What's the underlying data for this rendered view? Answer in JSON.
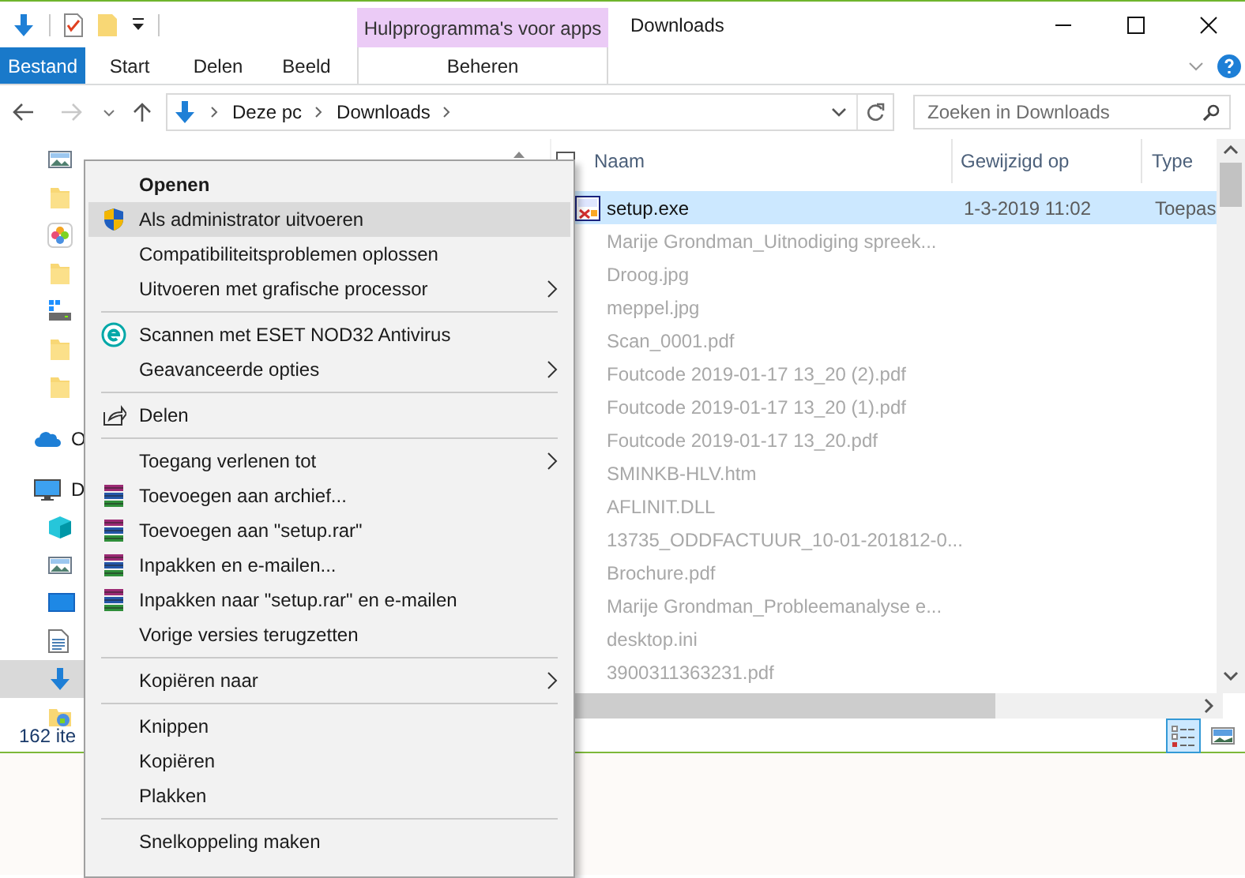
{
  "window": {
    "title": "Downloads",
    "context_tab": "Hulpprogramma's voor apps"
  },
  "ribbon": {
    "tabs": [
      {
        "label": "Bestand",
        "kind": "file",
        "selected": false
      },
      {
        "label": "Start",
        "kind": "tab",
        "selected": false
      },
      {
        "label": "Delen",
        "kind": "tab",
        "selected": false
      },
      {
        "label": "Beeld",
        "kind": "tab",
        "selected": false
      },
      {
        "label": "Beheren",
        "kind": "context",
        "selected": false
      }
    ]
  },
  "address_bar": {
    "segments": [
      "Deze pc",
      "Downloads"
    ]
  },
  "search": {
    "placeholder": "Zoeken in Downloads"
  },
  "sidebar": {
    "items": [
      {
        "selected": false
      },
      {
        "selected": false
      },
      {
        "selected": false
      },
      {
        "selected": false
      },
      {
        "selected": false
      },
      {
        "selected": false
      },
      {
        "selected": false
      },
      {
        "label": "O",
        "selected": false
      },
      {
        "label": "D",
        "selected": false,
        "children": [
          {
            "selected": false
          },
          {
            "selected": false
          },
          {
            "selected": false
          },
          {
            "selected": false
          },
          {
            "selected": true
          },
          {
            "selected": false
          }
        ]
      }
    ]
  },
  "file_list": {
    "columns": [
      "Naam",
      "Gewijzigd op",
      "Type"
    ],
    "rows": [
      {
        "name": "setup.exe",
        "modified": "1-3-2019 11:02",
        "type": "Toepas",
        "selected": true,
        "faded": false
      },
      {
        "name": "Marije Grondman_Uitnodiging spreek...",
        "selected": false,
        "faded": true
      },
      {
        "name": "Droog.jpg",
        "selected": false,
        "faded": true
      },
      {
        "name": "meppel.jpg",
        "selected": false,
        "faded": true
      },
      {
        "name": "Scan_0001.pdf",
        "selected": false,
        "faded": true
      },
      {
        "name": "Foutcode 2019-01-17 13_20 (2).pdf",
        "selected": false,
        "faded": true
      },
      {
        "name": "Foutcode 2019-01-17 13_20 (1).pdf",
        "selected": false,
        "faded": true
      },
      {
        "name": "Foutcode 2019-01-17 13_20.pdf",
        "selected": false,
        "faded": true
      },
      {
        "name": "SMINKB-HLV.htm",
        "selected": false,
        "faded": true
      },
      {
        "name": "AFLINIT.DLL",
        "selected": false,
        "faded": true
      },
      {
        "name": "13735_ODDFACTUUR_10-01-201812-0...",
        "selected": false,
        "faded": true
      },
      {
        "name": "Brochure.pdf",
        "selected": false,
        "faded": true
      },
      {
        "name": "Marije Grondman_Probleemanalyse e...",
        "selected": false,
        "faded": true
      },
      {
        "name": "desktop.ini",
        "selected": false,
        "faded": true
      },
      {
        "name": "3900311363231.pdf",
        "selected": false,
        "faded": true
      }
    ]
  },
  "status_bar": {
    "item_count": "162 ite"
  },
  "view_buttons": [
    {
      "kind": "details",
      "selected": true
    },
    {
      "kind": "tiles",
      "selected": false
    }
  ],
  "context_menu": {
    "items": [
      {
        "kind": "item",
        "label": "Openen",
        "bold": true,
        "selected": false,
        "submenu": false
      },
      {
        "kind": "item",
        "label": "Als administrator uitvoeren",
        "selected": true,
        "submenu": false
      },
      {
        "kind": "item",
        "label": "Compatibiliteitsproblemen oplossen",
        "selected": false,
        "submenu": false
      },
      {
        "kind": "item",
        "label": "Uitvoeren met grafische processor",
        "selected": false,
        "submenu": true
      },
      {
        "kind": "separator"
      },
      {
        "kind": "item",
        "label": "Scannen met ESET NOD32 Antivirus",
        "selected": false,
        "submenu": false
      },
      {
        "kind": "item",
        "label": "Geavanceerde opties",
        "selected": false,
        "submenu": true
      },
      {
        "kind": "separator"
      },
      {
        "kind": "item",
        "label": "Delen",
        "selected": false,
        "submenu": false
      },
      {
        "kind": "separator"
      },
      {
        "kind": "item",
        "label": "Toegang verlenen tot",
        "selected": false,
        "submenu": true
      },
      {
        "kind": "item",
        "label": "Toevoegen aan archief...",
        "selected": false,
        "submenu": false
      },
      {
        "kind": "item",
        "label": "Toevoegen aan \"setup.rar\"",
        "selected": false,
        "submenu": false
      },
      {
        "kind": "item",
        "label": "Inpakken en e-mailen...",
        "selected": false,
        "submenu": false
      },
      {
        "kind": "item",
        "label": "Inpakken naar \"setup.rar\" en e-mailen",
        "selected": false,
        "submenu": false
      },
      {
        "kind": "item",
        "label": "Vorige versies terugzetten",
        "selected": false,
        "submenu": false
      },
      {
        "kind": "separator"
      },
      {
        "kind": "item",
        "label": "Kopiëren naar",
        "selected": false,
        "submenu": true
      },
      {
        "kind": "separator"
      },
      {
        "kind": "item",
        "label": "Knippen",
        "selected": false,
        "submenu": false
      },
      {
        "kind": "item",
        "label": "Kopiëren",
        "selected": false,
        "submenu": false
      },
      {
        "kind": "item",
        "label": "Plakken",
        "selected": false,
        "submenu": false
      },
      {
        "kind": "separator"
      },
      {
        "kind": "item",
        "label": "Snelkoppeling maken",
        "selected": false,
        "submenu": false
      }
    ]
  }
}
